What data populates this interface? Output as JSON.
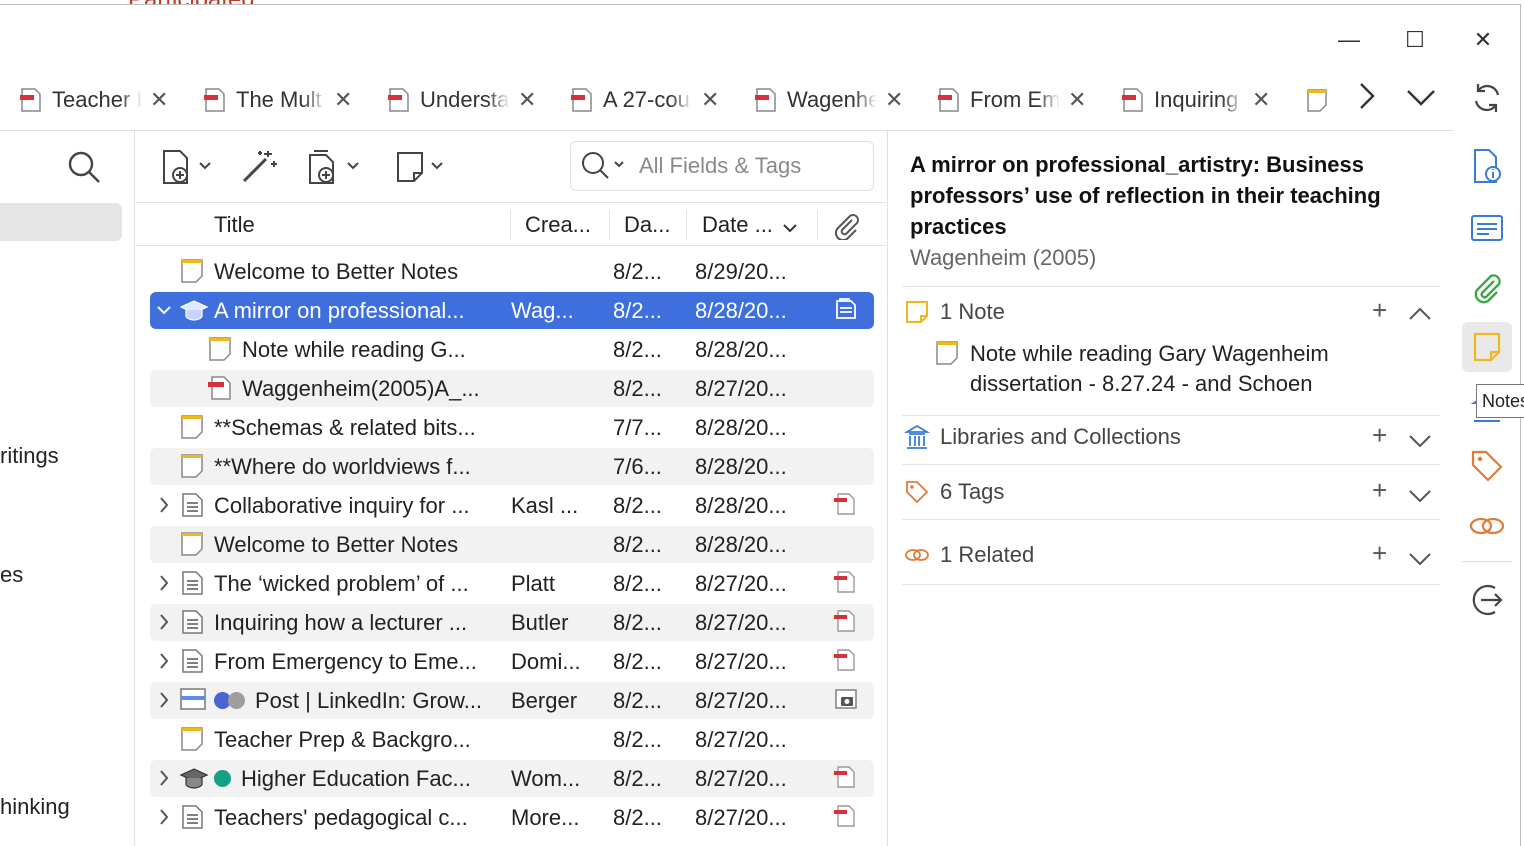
{
  "background_window": {
    "partial_text": "Participated"
  },
  "window_controls": {
    "minimize": "—",
    "maximize": "☐",
    "close": "✕"
  },
  "tabs": [
    {
      "label": "Teacher I"
    },
    {
      "label": "The Mult"
    },
    {
      "label": "Understa"
    },
    {
      "label": "A 27-cou"
    },
    {
      "label": "Wagenhe"
    },
    {
      "label": "From Em"
    },
    {
      "label": "Inquiring"
    }
  ],
  "left_pane": {
    "visible_fragments": [
      "ritings",
      "es",
      "hinking"
    ]
  },
  "toolbar": {
    "search_placeholder": "All Fields & Tags"
  },
  "columns": {
    "title": "Title",
    "creator": "Crea...",
    "date_added": "Da...",
    "date_modified": "Date ..."
  },
  "items": [
    {
      "title": "Welcome to Better Notes",
      "creator": "",
      "date_added": "8/2...",
      "date_modified": "8/29/20...",
      "type": "note",
      "indent": 0,
      "twisty": "",
      "attachment": ""
    },
    {
      "title": "A mirror on professional...",
      "creator": "Wag...",
      "date_added": "8/2...",
      "date_modified": "8/28/20...",
      "type": "thesis",
      "indent": 0,
      "twisty": "open",
      "attachment": "note",
      "selected": true
    },
    {
      "title": "Note while reading G...",
      "creator": "",
      "date_added": "8/2...",
      "date_modified": "8/28/20...",
      "type": "note",
      "indent": 1,
      "twisty": "",
      "attachment": ""
    },
    {
      "title": "Waggenheim(2005)A_...",
      "creator": "",
      "date_added": "8/2...",
      "date_modified": "8/27/20...",
      "type": "pdf",
      "indent": 1,
      "twisty": "",
      "attachment": ""
    },
    {
      "title": "**Schemas & related bits...",
      "creator": "",
      "date_added": "7/7...",
      "date_modified": "8/28/20...",
      "type": "note",
      "indent": 0,
      "twisty": "",
      "attachment": ""
    },
    {
      "title": "**Where do worldviews f...",
      "creator": "",
      "date_added": "7/6...",
      "date_modified": "8/28/20...",
      "type": "note",
      "indent": 0,
      "twisty": "",
      "attachment": ""
    },
    {
      "title": "Collaborative inquiry for ...",
      "creator": "Kasl ...",
      "date_added": "8/2...",
      "date_modified": "8/28/20...",
      "type": "doc",
      "indent": 0,
      "twisty": "closed",
      "attachment": "pdf"
    },
    {
      "title": "Welcome to Better Notes",
      "creator": "",
      "date_added": "8/2...",
      "date_modified": "8/28/20...",
      "type": "note",
      "indent": 0,
      "twisty": "",
      "attachment": ""
    },
    {
      "title": "The ‘wicked problem’ of ...",
      "creator": "Platt",
      "date_added": "8/2...",
      "date_modified": "8/27/20...",
      "type": "doc",
      "indent": 0,
      "twisty": "closed",
      "attachment": "pdf"
    },
    {
      "title": "Inquiring how a lecturer ...",
      "creator": "Butler",
      "date_added": "8/2...",
      "date_modified": "8/27/20...",
      "type": "doc",
      "indent": 0,
      "twisty": "closed",
      "attachment": "pdf"
    },
    {
      "title": "From Emergency to Eme...",
      "creator": "Domi...",
      "date_added": "8/2...",
      "date_modified": "8/27/20...",
      "type": "doc",
      "indent": 0,
      "twisty": "closed",
      "attachment": "pdf"
    },
    {
      "title": "Post | LinkedIn: Grow...",
      "creator": "Berger",
      "date_added": "8/2...",
      "date_modified": "8/27/20...",
      "type": "web",
      "indent": 0,
      "twisty": "closed",
      "attachment": "snapshot",
      "dots": [
        "#4a64d4",
        "#9e9e9e"
      ]
    },
    {
      "title": "Teacher Prep & Backgro...",
      "creator": "",
      "date_added": "8/2...",
      "date_modified": "8/27/20...",
      "type": "note",
      "indent": 0,
      "twisty": "",
      "attachment": ""
    },
    {
      "title": "Higher Education Fac...",
      "creator": "Wom...",
      "date_added": "8/2...",
      "date_modified": "8/27/20...",
      "type": "thesis",
      "indent": 0,
      "twisty": "closed",
      "attachment": "pdf",
      "dots": [
        "#14a085"
      ]
    },
    {
      "title": "Teachers' pedagogical c...",
      "creator": "More...",
      "date_added": "8/2...",
      "date_modified": "8/27/20...",
      "type": "doc",
      "indent": 0,
      "twisty": "closed",
      "attachment": "pdf"
    }
  ],
  "item_pane": {
    "title": "A mirror on professional_artistry: Business professors’ use of reflection in their teaching practices",
    "subtitle": "Wagenheim (2005)",
    "notes": {
      "header": "1 Note",
      "items": [
        "Note while reading Gary Wagenheim dissertation - 8.27.24 - and Schoen"
      ]
    },
    "libraries_header": "Libraries and Collections",
    "tags_header": "6 Tags",
    "related_header": "1 Related"
  },
  "tooltip": "Notes",
  "colors": {
    "selection": "#3f6fdc",
    "accent_orange": "#e07b39",
    "note_yellow": "#f3b61f",
    "pdf_red": "#d6303c",
    "icon_blue": "#3a7bd5",
    "icon_green": "#3aa845"
  }
}
